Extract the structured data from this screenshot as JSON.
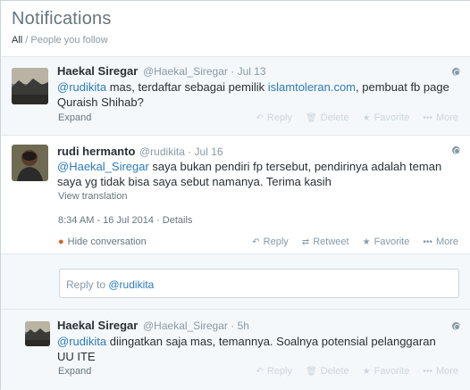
{
  "header": {
    "title": "Notifications",
    "filter_all": "All",
    "filter_sep": "/",
    "filter_people": "People you follow"
  },
  "tweets": [
    {
      "name": "Haekal Siregar",
      "handle": "@Haekal_Siregar",
      "time": "Jul 13",
      "text_mention": "@rudikita",
      "text_pre": " mas, terdaftar sebagai pemilik ",
      "text_link": "islamtoleran.com",
      "text_post": ", pembuat fb page Quraish Shihab?",
      "expand": "Expand",
      "actions": [
        "Reply",
        "Delete",
        "Favorite",
        "More"
      ]
    },
    {
      "name": "rudi hermanto",
      "handle": "@rudikita",
      "time": "Jul 16",
      "text_mention": "@Haekal_Siregar",
      "text_rest": " saya bukan pendiri fp tersebut, pendirinya adalah teman saya yg tidak bisa saya sebut namanya. Terima kasih",
      "view_translation": "View translation",
      "timestamp": "8:34 AM - 16 Jul 2014",
      "details": "Details",
      "hide": "Hide conversation",
      "actions": [
        "Reply",
        "Retweet",
        "Favorite",
        "More"
      ]
    },
    {
      "name": "Haekal Siregar",
      "handle": "@Haekal_Siregar",
      "time": "5h",
      "text_mention": "@rudikita",
      "text_rest": " diingatkan saja mas, temannya. Soalnya potensial pelanggaran UU ITE",
      "expand": "Expand",
      "actions": [
        "Reply",
        "Delete",
        "Favorite",
        "More"
      ]
    }
  ],
  "reply_box": {
    "label": "Reply to",
    "mention": "@rudikita"
  },
  "icons": {
    "reply": "reply-icon",
    "retweet": "retweet-icon",
    "delete": "trash-icon",
    "favorite": "star-icon",
    "more": "more-dots-icon",
    "hide": "speech-bubble-icon",
    "globe": "globe-icon"
  },
  "colors": {
    "link": "#2b7bb9",
    "muted": "#8899a6",
    "hover_bg": "#f5f8fa",
    "hide_icon": "#d4651f"
  }
}
